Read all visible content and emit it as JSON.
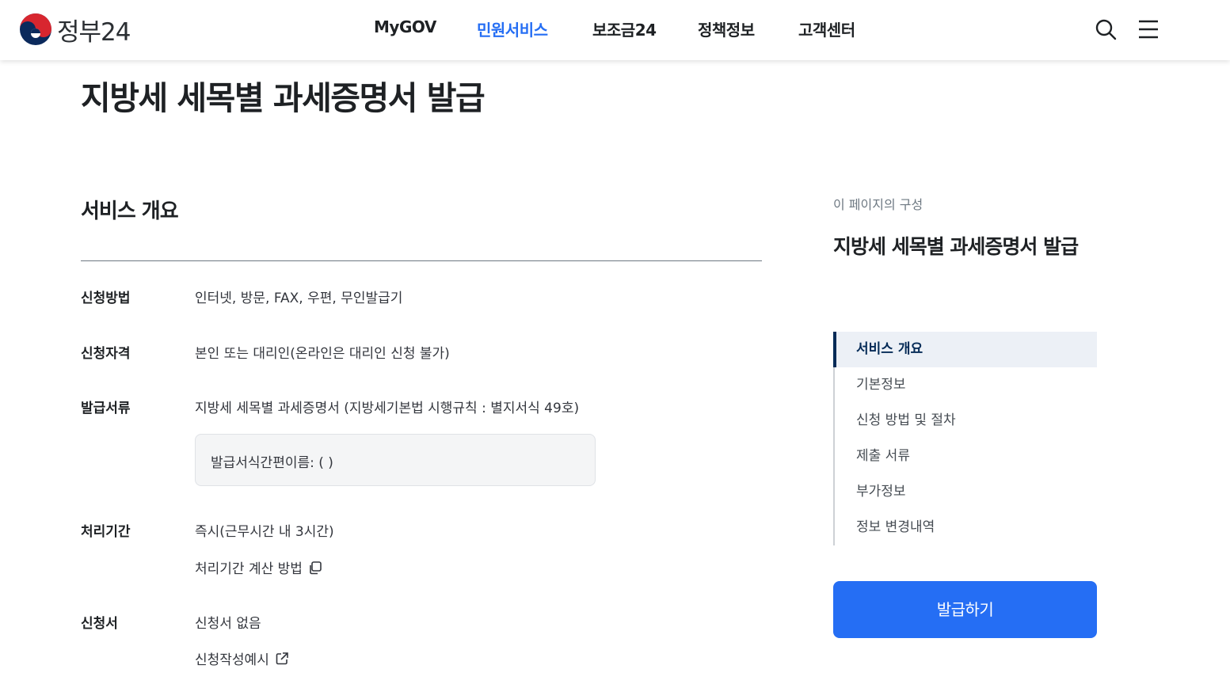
{
  "header": {
    "logo_text": "정부24",
    "nav": [
      {
        "label": "MyGOV",
        "active": false
      },
      {
        "label": "민원서비스",
        "active": true
      },
      {
        "label": "보조금24",
        "active": false
      },
      {
        "label": "정책정보",
        "active": false
      },
      {
        "label": "고객센터",
        "active": false
      }
    ],
    "icons": [
      "search-icon",
      "menu-icon"
    ]
  },
  "page_title": "지방세 세목별 과세증명서 발급",
  "overview": {
    "title": "서비스 개요",
    "rows": [
      {
        "label": "신청방법",
        "value": "인터넷, 방문, FAX, 우편, 무인발급기"
      },
      {
        "label": "신청자격",
        "value": "본인 또는 대리인(온라인은 대리인 신청 불가)"
      },
      {
        "label": "발급서류",
        "value": "지방세 세목별 과세증명서 (지방세기본법 시행규칙 : 별지서식 49호)"
      },
      {
        "label": "처리기간",
        "value": "즉시(근무시간 내 3시간)"
      },
      {
        "label": "신청서",
        "value": "신청서 없음"
      }
    ],
    "form_box_text": "발급서식간편이름: ( )",
    "processing_link": "처리기간 계산 방법",
    "example_link": "신청작성예시"
  },
  "sidebar": {
    "caption": "이 페이지의 구성",
    "title": "지방세 세목별 과세증명서 발급",
    "items": [
      {
        "label": "서비스 개요",
        "active": true
      },
      {
        "label": "기본정보",
        "active": false
      },
      {
        "label": "신청 방법 및 절차",
        "active": false
      },
      {
        "label": "제출 서류",
        "active": false
      },
      {
        "label": "부가정보",
        "active": false
      },
      {
        "label": "정보 변경내역",
        "active": false
      }
    ],
    "button_label": "발급하기"
  },
  "colors": {
    "accent": "#256ef4",
    "nav_active": "#256ef4",
    "toc_active_bg": "#ecf0f6",
    "toc_active_text": "#052b57"
  }
}
